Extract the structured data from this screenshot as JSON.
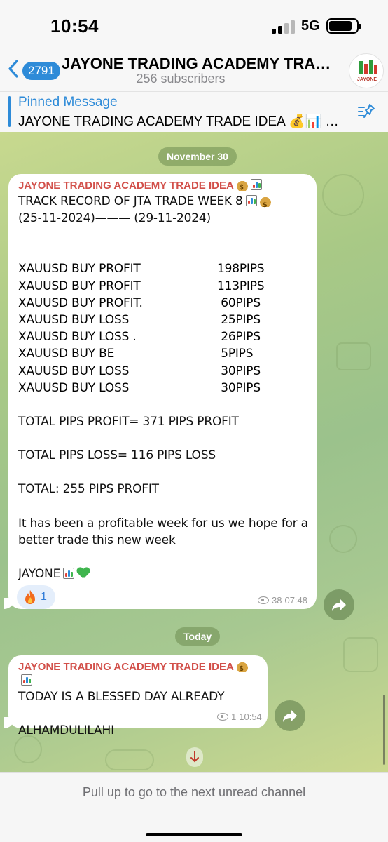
{
  "status_bar": {
    "time": "10:54",
    "network": "5G",
    "battery_level": 0.85
  },
  "header": {
    "back_count": "2791",
    "title": "JAYONE TRADING ACADEMY TRAD...",
    "subscribers": "256 subscribers",
    "avatar_text": "JAYONE"
  },
  "pinned": {
    "title": "Pinned Message",
    "text": "JAYONE TRADING ACADEMY TRADE IDEA 💰📊 XA..."
  },
  "dates": {
    "first": "November 30",
    "second": "Today"
  },
  "message1": {
    "sender": "JAYONE TRADING ACADEMY TRADE IDEA",
    "line1": "TRACK RECORD OF JTA TRADE WEEK 8",
    "line2": "(25-11-2024)——— (29-11-2024)",
    "trades": [
      {
        "label": "XAUUSD BUY  PROFIT",
        "value": "198PIPS"
      },
      {
        "label": "XAUUSD BUY PROFIT",
        "value": "113PIPS"
      },
      {
        "label": "XAUUSD BUY PROFIT.",
        "value": " 60PIPS"
      },
      {
        "label": "XAUUSD BUY LOSS",
        "value": " 25PIPS"
      },
      {
        "label": "XAUUSD BUY LOSS .",
        "value": " 26PIPS"
      },
      {
        "label": "XAUUSD BUY BE",
        "value": " 5PIPS"
      },
      {
        "label": "XAUUSD BUY LOSS",
        "value": " 30PIPS"
      },
      {
        "label": "XAUUSD BUY LOSS",
        "value": " 30PIPS"
      }
    ],
    "total_profit": "TOTAL PIPS PROFIT= 371 PIPS PROFIT",
    "total_loss": "TOTAL PIPS LOSS= 116 PIPS LOSS",
    "total": "TOTAL: 255 PIPS PROFIT",
    "closing1": "It has been a profitable week for us we hope for a",
    "closing2": "better trade this new week",
    "signature": "JAYONE",
    "reaction_count": "1",
    "views": "38",
    "time": "07:48"
  },
  "message2": {
    "sender": "JAYONE TRADING ACADEMY TRADE IDEA",
    "line1": "TODAY IS A BLESSED DAY ALREADY",
    "line2": "ALHAMDULILAHI",
    "views": "1",
    "time": "10:54"
  },
  "bottom": {
    "hint": "Pull up to go to the next unread channel"
  },
  "colors": {
    "accent": "#2e8bd8",
    "sender": "#d2504a",
    "chat_bg": "#a9c986"
  }
}
